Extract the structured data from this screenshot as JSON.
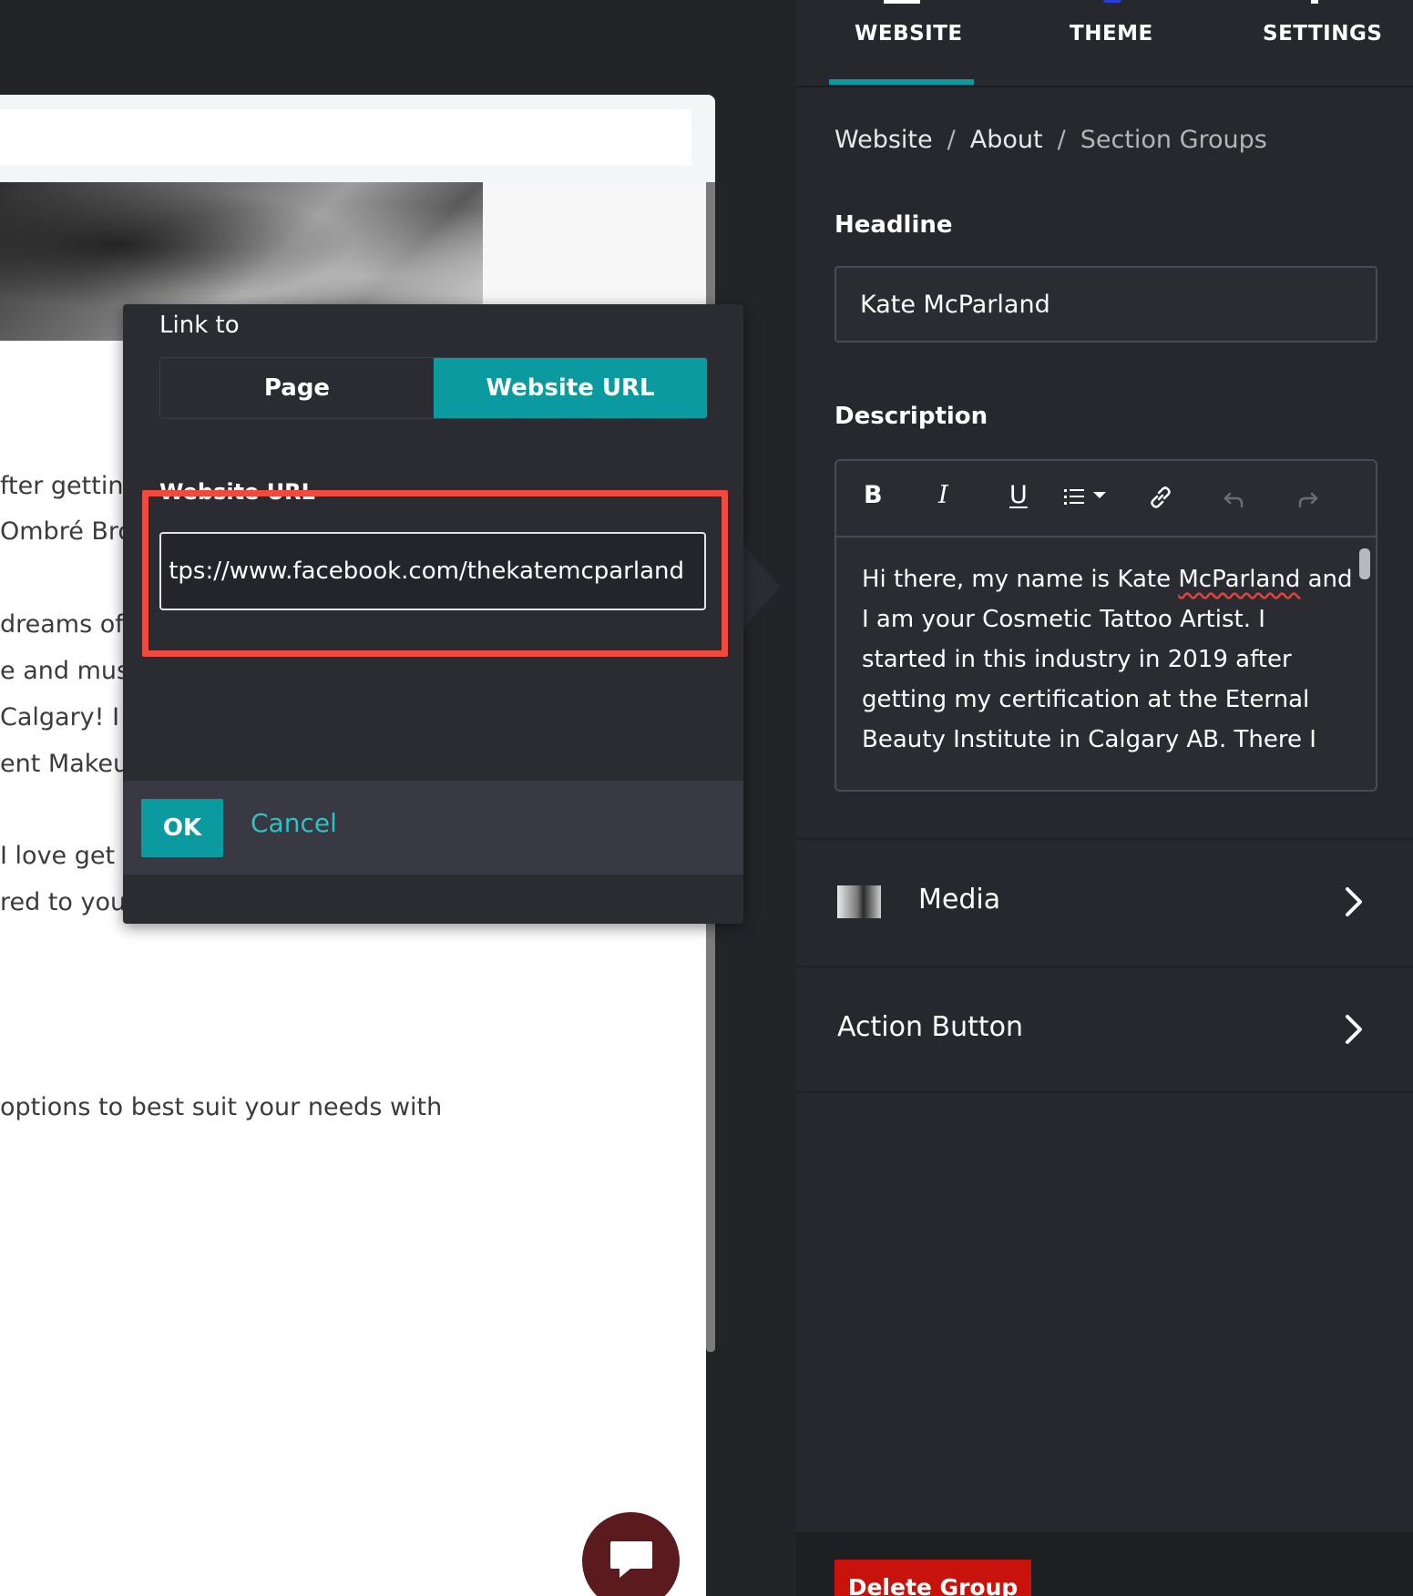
{
  "preview": {
    "body_lines": [
      "fter getting",
      "Ombré Bro",
      "dreams of",
      "e and mus",
      "Calgary! I g",
      "ent Makeu",
      "I love get",
      "red to you",
      "options to best suit your needs with"
    ]
  },
  "modal": {
    "title": "Link to",
    "tabs": [
      "Page",
      "Website URL"
    ],
    "active_tab": "Website URL",
    "url_label": "Website URL",
    "url_value": "tps://www.facebook.com/thekatemcparland",
    "ok_label": "OK",
    "cancel_label": "Cancel"
  },
  "right_panel": {
    "tabs": [
      "WEBSITE",
      "THEME",
      "SETTINGS"
    ],
    "active_tab": "WEBSITE",
    "breadcrumb": [
      "Website",
      "About",
      "Section Groups"
    ],
    "headline_label": "Headline",
    "headline_value": "Kate McParland",
    "description_label": "Description",
    "description_lines": [
      "Hi  there, my name is Kate ",
      "McParland",
      " and",
      "I am your Cosmetic Tattoo Artist. I",
      "started in this industry in 2019 after",
      "getting my certification at the  Eternal",
      "Beauty Institute in Calgary AB. There I"
    ],
    "toolbar": {
      "bold": "B",
      "italic": "I",
      "underline": "U"
    },
    "media_label": "Media",
    "action_button_label": "Action Button",
    "delete_label": "Delete Group"
  },
  "colors": {
    "accent": "#0a9a9f",
    "highlight": "#f0493d",
    "delete": "#c8120c",
    "panel_bg": "#27282d"
  },
  "icons": [
    "chevron-right-icon",
    "bold-icon",
    "italic-icon",
    "underline-icon",
    "list-icon",
    "link-icon",
    "undo-icon",
    "redo-icon",
    "chat-icon"
  ]
}
